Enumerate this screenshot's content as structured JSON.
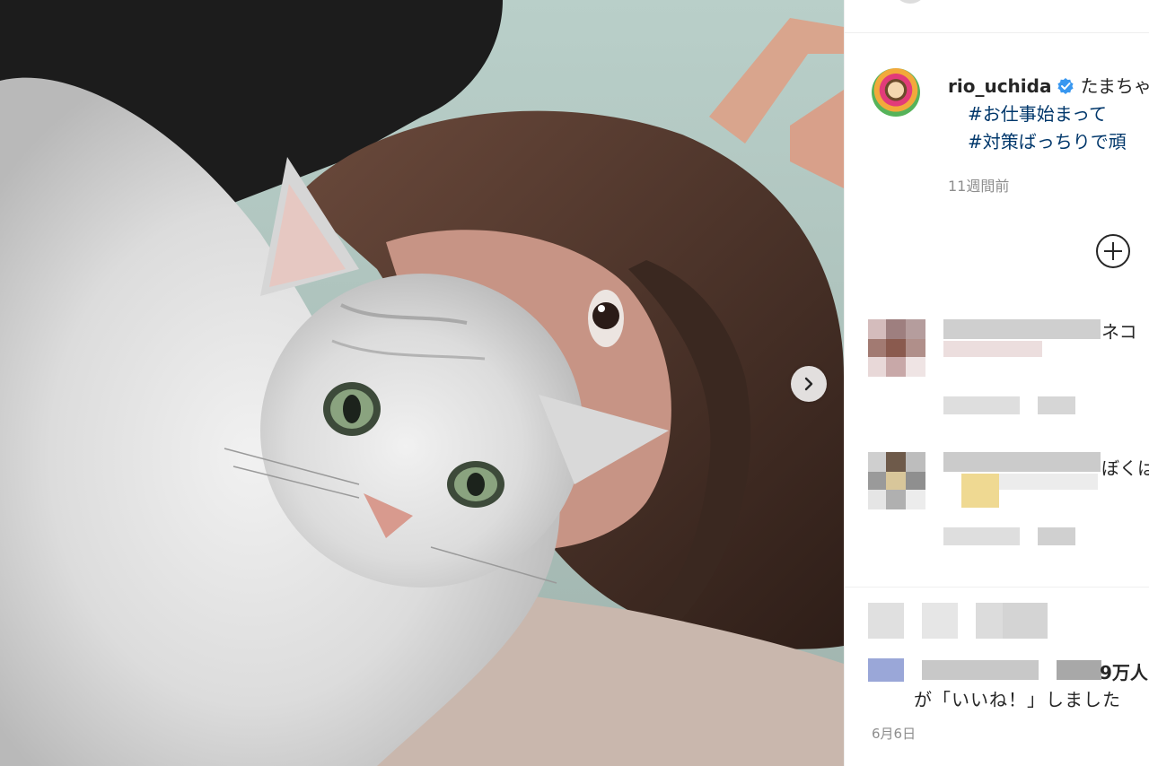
{
  "post": {
    "username": "rio_uchida",
    "caption_start": "たまちゃ",
    "hashtags": [
      "#お仕事始まって",
      "#対策ばっちりで頑"
    ],
    "time_ago": "11週間前",
    "photo_description": "cat-and-woman-photo"
  },
  "comments": [
    {
      "visible_text": "ネコ"
    },
    {
      "visible_text": "ぼくは"
    }
  ],
  "likes": {
    "line1": "9万人",
    "line2": "が「いいね！」しました"
  },
  "date": "6月6日",
  "colors": {
    "hashtag": "#00376b",
    "verified": "#3897f0",
    "secondary_text": "#8e8e8e"
  }
}
